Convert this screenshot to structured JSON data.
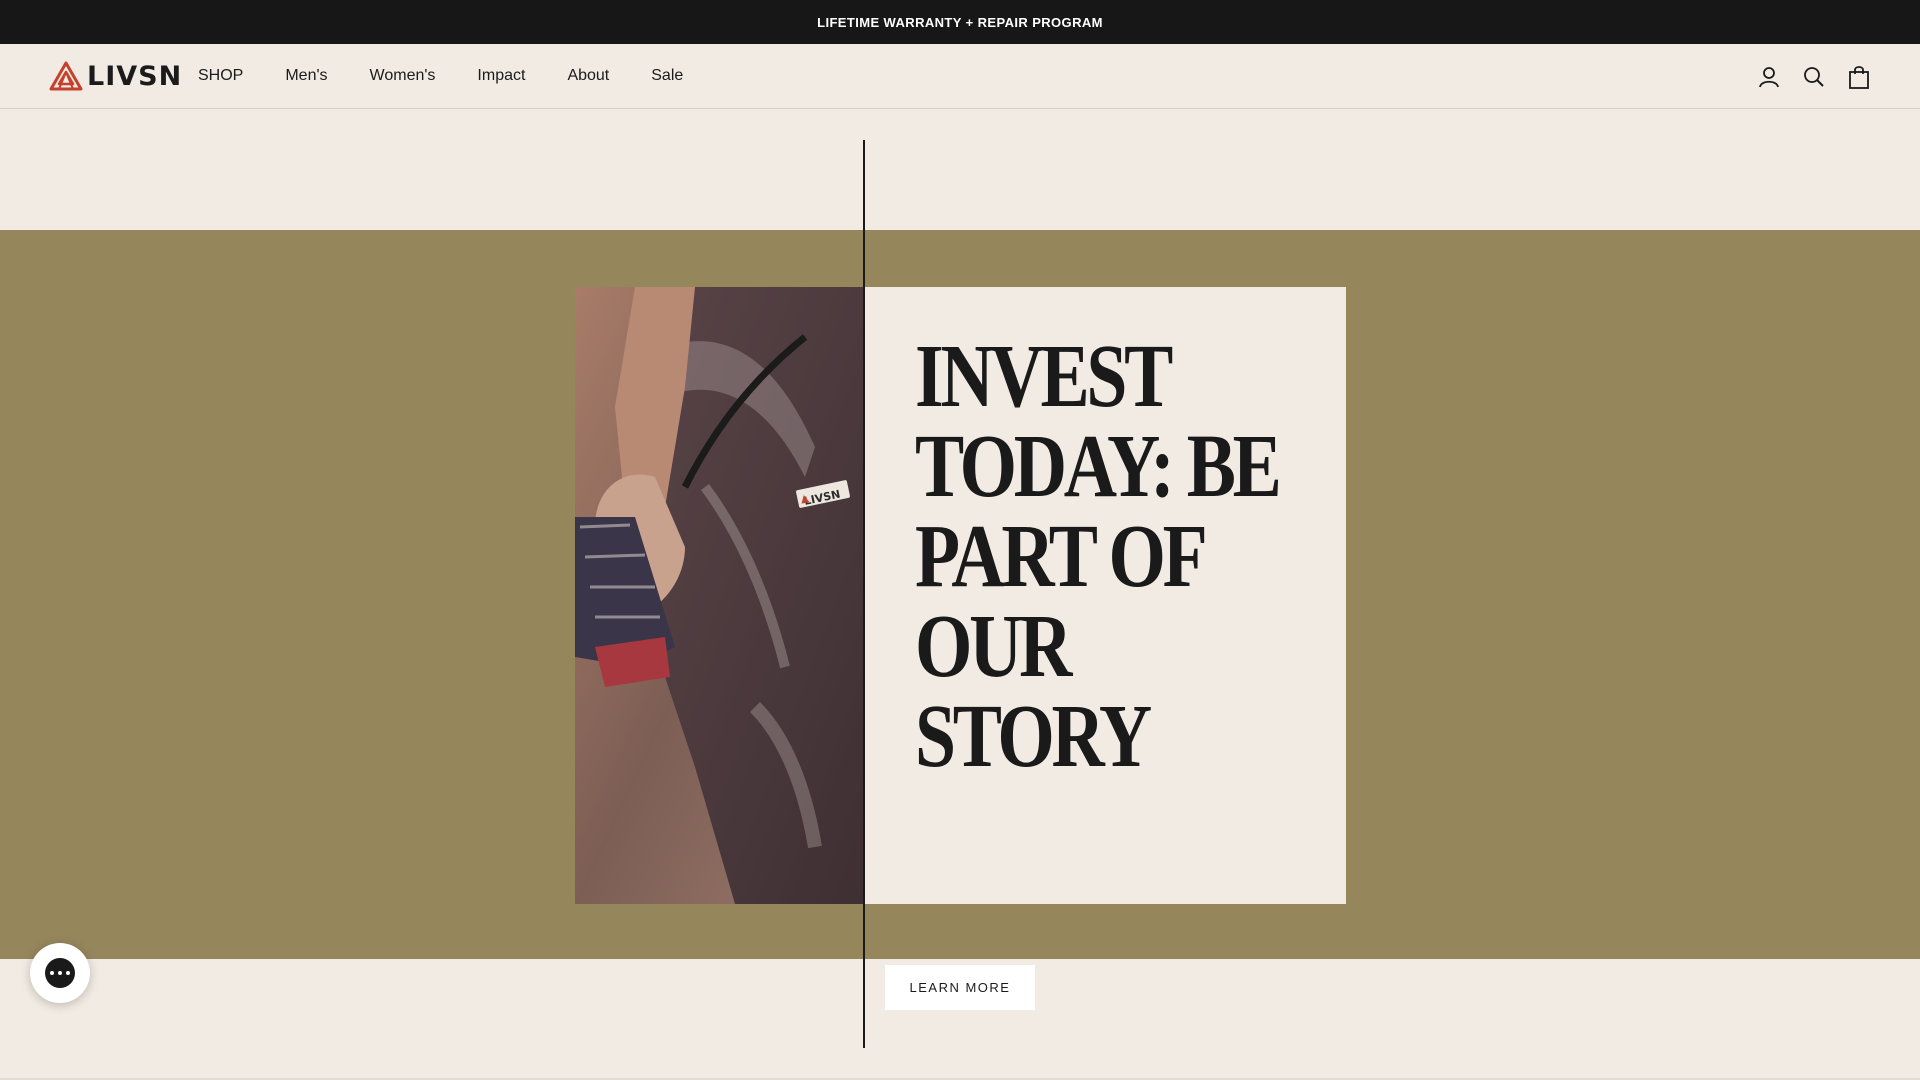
{
  "announcement": {
    "text": "LIFETIME WARRANTY + REPAIR PROGRAM"
  },
  "header": {
    "logo_text": "LIVSN",
    "nav": [
      "SHOP",
      "Men's",
      "Women's",
      "Impact",
      "About",
      "Sale"
    ],
    "icons": [
      "account-icon",
      "search-icon",
      "cart-icon"
    ]
  },
  "hero": {
    "headline_lines": [
      "INVEST",
      "TODAY: BE",
      "PART OF",
      "OUR",
      "STORY"
    ],
    "button_label": "LEARN MORE",
    "badge_text": "LIVSN"
  },
  "colors": {
    "background": "#f1ebe3",
    "band": "#96865c",
    "announcement_bar": "#171717",
    "logo_accent": "#c4412b"
  }
}
